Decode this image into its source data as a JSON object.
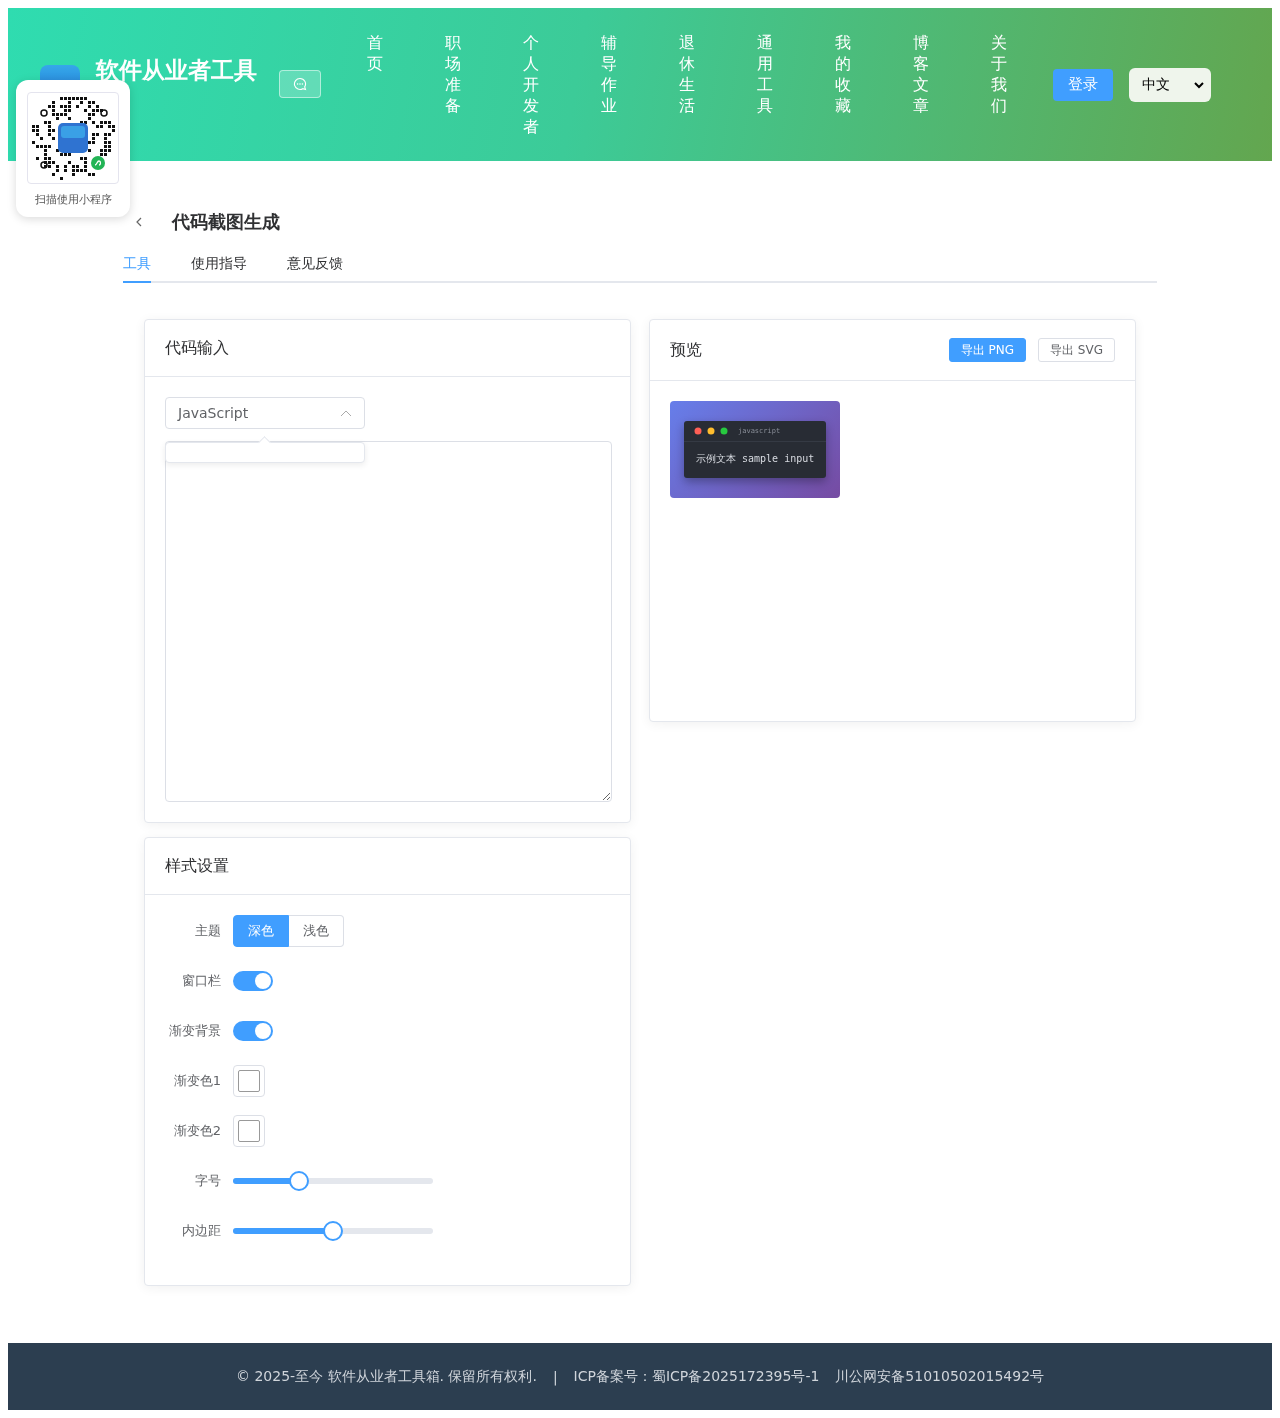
{
  "header": {
    "title": "软件从业者工具",
    "nav": [
      {
        "label": "首页"
      },
      {
        "label": "职场准备"
      },
      {
        "label": "个人开发者"
      },
      {
        "label": "辅导作业"
      },
      {
        "label": "退休生活"
      },
      {
        "label": "通用工具"
      },
      {
        "label": "我的收藏"
      },
      {
        "label": "博客文章"
      },
      {
        "label": "关于我们"
      }
    ],
    "login": "登录",
    "language": "中文"
  },
  "qr_popup": {
    "caption": "扫描使用小程序"
  },
  "page": {
    "title": "代码截图生成",
    "tabs": [
      {
        "label": "工具",
        "selected": true
      },
      {
        "label": "使用指导",
        "selected": false
      },
      {
        "label": "意见反馈",
        "selected": false
      }
    ]
  },
  "code_input": {
    "title": "代码输入",
    "language": "JavaScript",
    "expanded": true
  },
  "preview": {
    "title": "预览",
    "buttons": [
      {
        "label": "导出 PNG",
        "primary": true
      },
      {
        "label": "导出 SVG",
        "primary": false
      }
    ],
    "image": {
      "language": "javascript",
      "code": "示例文本 sample input"
    }
  },
  "style_settings": {
    "title": "样式设置",
    "rows": [
      {
        "kind": "segmented",
        "label": "主题",
        "options": [
          {
            "label": "深色",
            "selected": true
          },
          {
            "label": "浅色",
            "selected": false
          }
        ]
      },
      {
        "kind": "switch",
        "label": "窗口栏",
        "on": true
      },
      {
        "kind": "switch",
        "label": "渐变背景",
        "on": true
      },
      {
        "kind": "color",
        "label": "渐变色1"
      },
      {
        "kind": "color",
        "label": "渐变色2"
      },
      {
        "kind": "slider",
        "label": "字号",
        "level": 0.33
      },
      {
        "kind": "slider",
        "label": "内边距",
        "level": 0.5
      }
    ]
  },
  "footer": {
    "copyright": "© 2025-至今 软件从业者工具箱. 保留所有权利.",
    "separator": "|",
    "icp": "ICP备案号：蜀ICP备2025172395号-1",
    "police": "川公网安备51010502015492号"
  }
}
